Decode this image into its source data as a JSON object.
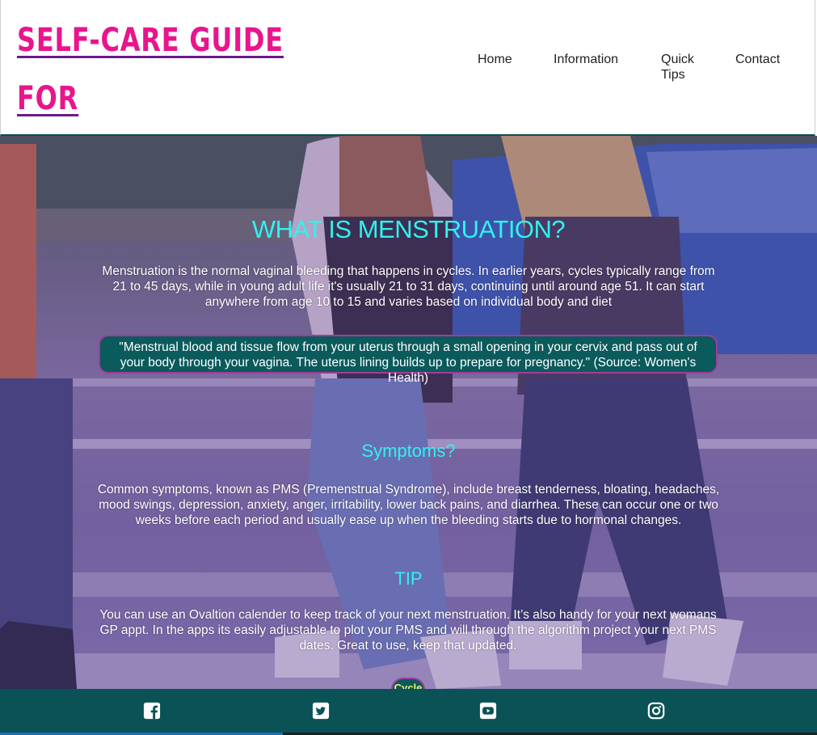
{
  "header": {
    "brand_title": "SELF-CARE GUIDE FOR\nYOUNG WOMAN",
    "nav": {
      "home": "Home",
      "information": "Information",
      "quick_tips": "Quick Tips",
      "contact": "Contact"
    }
  },
  "main": {
    "heading": "WHAT IS MENSTRUATION?",
    "intro": "Menstruation is the normal vaginal bleeding that happens in cycles. In earlier years, cycles typically range from 21 to 45 days, while in young adult life it's usually 21 to 31 days, continuing until around age 51. It can start anywhere from age 10 to 15 and varies based on individual body and diet",
    "quote": "\"Menstrual blood and tissue flow from your uterus through a small opening in your cervix and pass out of your body through your vagina. The uterus lining builds up to prepare for pregnancy.\" (Source: Women's Health)",
    "symptoms_heading": "Symptoms?",
    "symptoms_text": "Common symptoms, known as PMS (Premenstrual Syndrome), include breast tenderness, bloating, headaches, mood swings, depression, anxiety, anger, irritability, lower back pains, and diarrhea. These can occur one or two weeks before each period and usually ease up when the bleeding starts due to hormonal changes.",
    "tip_heading": "TIP",
    "tip_text": "You can use an Ovaltion calender to keep track of your next menstruation. It’s also handy for your next womans GP appt. In the apps its easily adjustable to plot your PMS and will through the algorithm project your next PMS dates. Great to use, keep that updated.",
    "partial_button": "Cycle"
  },
  "footer": {
    "icons": [
      "facebook-icon",
      "twitter-icon",
      "youtube-icon",
      "instagram-icon"
    ]
  },
  "colors": {
    "brand": "#e8158b",
    "accent_heading": "#2ff3ee",
    "teal": "#0a5255",
    "quote_border": "#a13c9b"
  }
}
